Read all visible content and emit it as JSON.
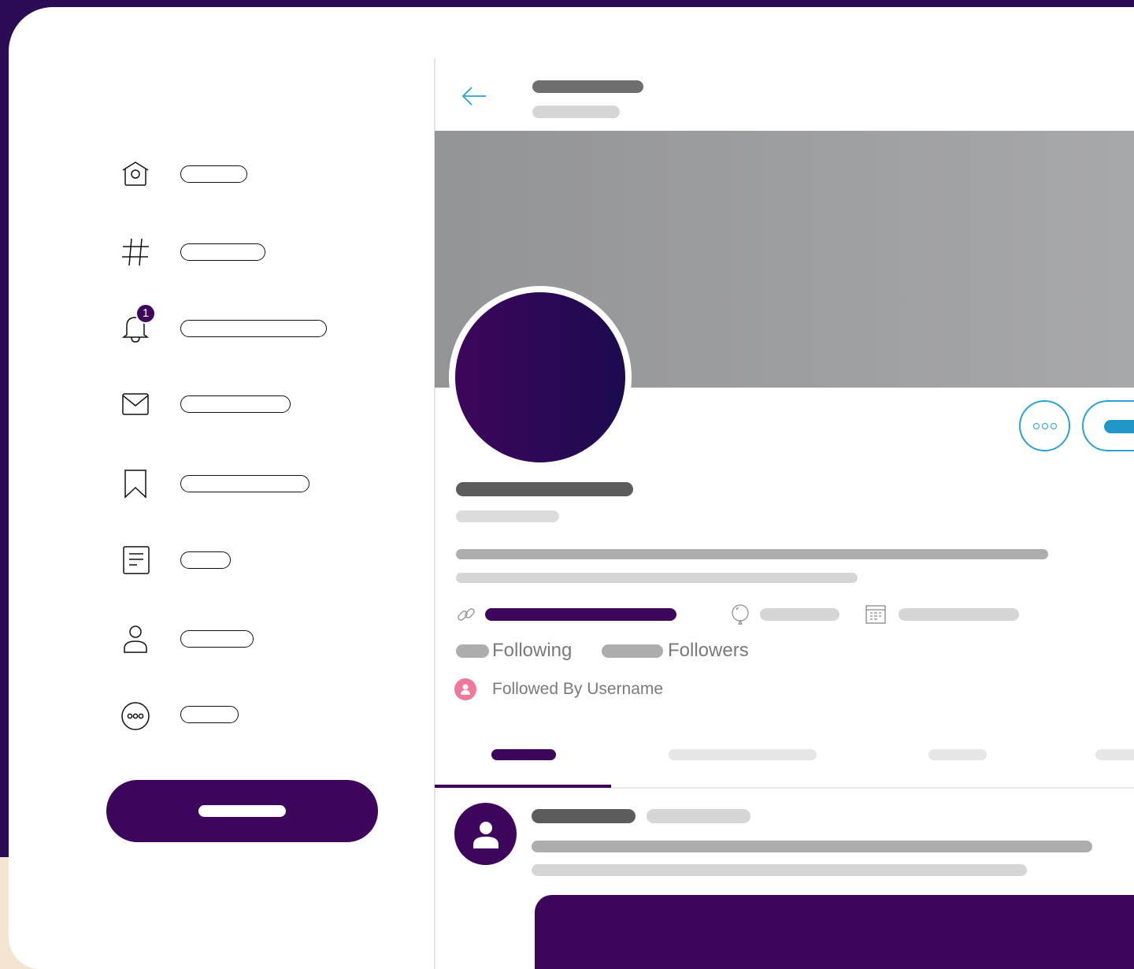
{
  "badge": {
    "count": "1"
  },
  "stats": {
    "following_label": "Following",
    "followers_label": "Followers"
  },
  "followed_by": {
    "text": "Followed By Username"
  },
  "icons": {
    "home": "home-icon",
    "explore": "hashtag-icon",
    "notifications": "bell-icon",
    "messages": "mail-icon",
    "bookmarks": "bookmark-icon",
    "lists": "list-icon",
    "profile": "user-icon",
    "more": "more-circle-icon",
    "back": "arrow-left-icon",
    "link": "link-icon",
    "birthday": "balloon-icon",
    "joined": "calendar-icon"
  },
  "colors": {
    "brand_purple": "#3d065c",
    "accent_blue": "#2aa0d3",
    "frame_bg": "#2b0b55",
    "cream": "#f3e5cf",
    "skeleton_dark": "#5c5c5c",
    "skeleton_mid": "#aaaaaa",
    "skeleton_light": "#d6d6d6"
  }
}
